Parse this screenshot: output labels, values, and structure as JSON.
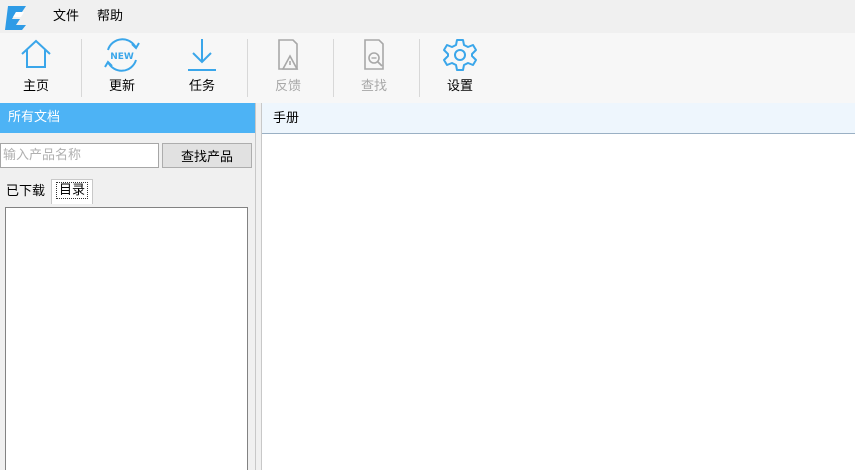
{
  "menu": {
    "logo_icon": "app-logo-icon",
    "items": [
      "文件",
      "帮助"
    ]
  },
  "toolbar": {
    "home": {
      "label": "主页",
      "icon": "home-icon",
      "enabled": true
    },
    "update": {
      "label": "更新",
      "icon": "update-new-icon",
      "badge": "NEW",
      "enabled": true
    },
    "tasks": {
      "label": "任务",
      "icon": "download-icon",
      "enabled": true
    },
    "feedback": {
      "label": "反馈",
      "icon": "feedback-icon",
      "enabled": false
    },
    "find": {
      "label": "查找",
      "icon": "search-document-icon",
      "enabled": false
    },
    "settings": {
      "label": "设置",
      "icon": "gear-icon",
      "enabled": true
    }
  },
  "left_panel": {
    "title": "所有文档",
    "search": {
      "placeholder": "输入产品名称",
      "value": "",
      "button_label": "查找产品"
    },
    "tabs": [
      {
        "label": "已下载",
        "selected": false
      },
      {
        "label": "目录",
        "selected": true
      }
    ]
  },
  "right_panel": {
    "title": "手册"
  },
  "colors": {
    "accent": "#4db3f5",
    "icon_blue": "#3aa6ea",
    "disabled_gray": "#a8a8a8"
  }
}
